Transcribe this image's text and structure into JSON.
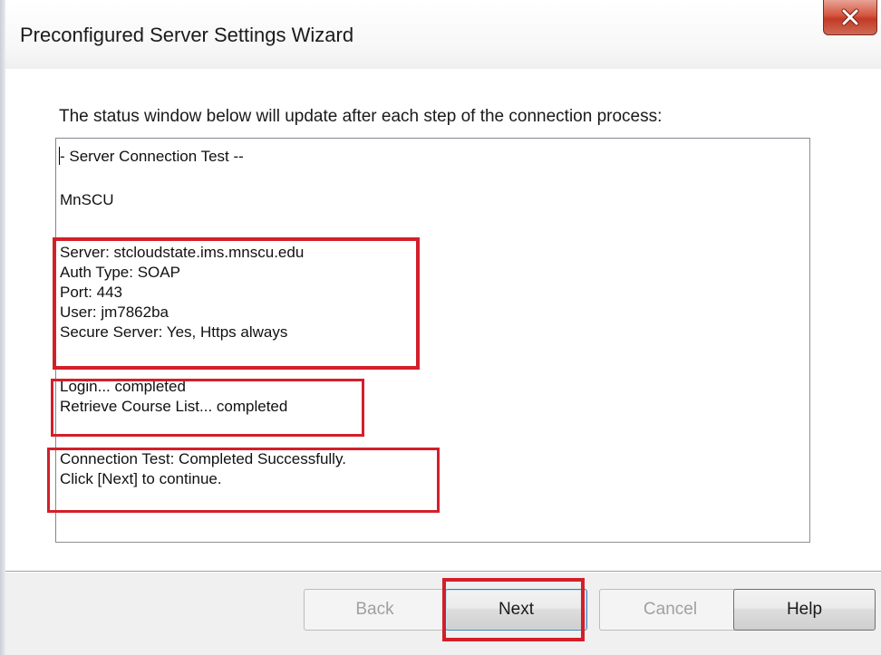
{
  "window": {
    "title": "Preconfigured Server Settings Wizard",
    "close_icon": "close-icon"
  },
  "instruction": "The status window below will update after each step of the connection process:",
  "status": {
    "lines": [
      "- Server Connection Test --",
      "MnSCU",
      "Server: stcloudstate.ims.mnscu.edu",
      "Auth Type: SOAP",
      "Port: 443",
      "User: jm7862ba",
      "Secure Server: Yes, Https always",
      "Login... completed",
      "Retrieve Course List... completed",
      "Connection Test: Completed Successfully.",
      "Click [Next] to continue."
    ]
  },
  "buttons": {
    "back": "Back",
    "next": "Next",
    "cancel": "Cancel",
    "help": "Help"
  },
  "colors": {
    "highlight": "#d31f2a",
    "close_button": "#c8412b"
  }
}
